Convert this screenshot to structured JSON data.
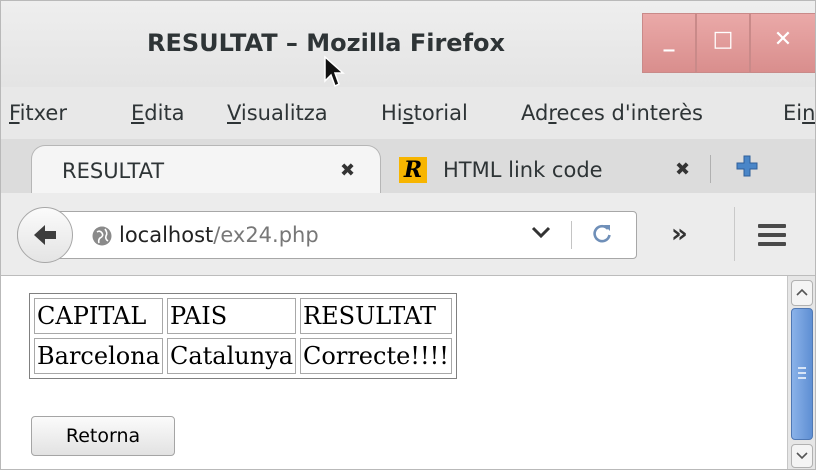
{
  "window": {
    "title": "RESULTAT – Mozilla Firefox",
    "controls": {
      "minimize": "_",
      "maximize": "□",
      "close": "✕"
    }
  },
  "menubar": {
    "items": [
      {
        "underline": "F",
        "rest": "itxer"
      },
      {
        "underline": "E",
        "rest": "dita"
      },
      {
        "underline": "V",
        "rest": "isualitza"
      },
      {
        "pre": "Hi",
        "underline": "s",
        "rest": "torial"
      },
      {
        "pre": "Ad",
        "underline": "r",
        "rest": "eces d'interès"
      },
      {
        "pre": "Ei",
        "underline": "n",
        "rest": ""
      }
    ]
  },
  "tabs": [
    {
      "label": "RESULTAT",
      "active": true,
      "close": "✖"
    },
    {
      "label": "HTML link code",
      "active": false,
      "favicon": "R",
      "close": "✖"
    }
  ],
  "navbar": {
    "url_host": "localhost",
    "url_path": "/ex24.php",
    "overflow": "»",
    "icons": [
      "back-arrow-icon",
      "globe-icon",
      "dropdown-chevron-icon",
      "reload-icon",
      "overflow-chevron-icon",
      "menu-hamburger-icon"
    ]
  },
  "page": {
    "table": {
      "headers": [
        "CAPITAL",
        "PAIS",
        "RESULTAT"
      ],
      "rows": [
        [
          "Barcelona",
          "Catalunya",
          "Correcte!!!!"
        ]
      ]
    },
    "button_label": "Retorna"
  },
  "colors": {
    "titlebar_buttons": "#d98e8d",
    "favicon_bg": "#f7b500",
    "newtab_plus": "#4a86c8",
    "scroll_thumb": "#5f8fd3"
  }
}
